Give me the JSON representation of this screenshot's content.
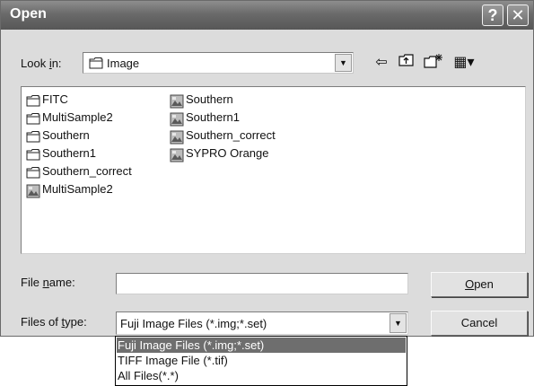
{
  "window": {
    "title": "Open",
    "help_glyph": "?",
    "close_glyph": "✕"
  },
  "lookin": {
    "label_pre": "Look ",
    "label_key": "i",
    "label_post": "n:",
    "value": "Image",
    "arrow": "▼"
  },
  "toolbar": {
    "back_glyph": "⇦",
    "up_glyph": "⇡",
    "new_folder_glyph": "✳",
    "views_glyph": "▦▾"
  },
  "files": [
    {
      "name": "FITC",
      "type": "folder"
    },
    {
      "name": "MultiSample2",
      "type": "folder"
    },
    {
      "name": "Southern",
      "type": "folder"
    },
    {
      "name": "Southern1",
      "type": "folder"
    },
    {
      "name": "Southern_correct",
      "type": "folder"
    },
    {
      "name": "MultiSample2",
      "type": "image"
    },
    {
      "name": "Southern",
      "type": "image"
    },
    {
      "name": "Southern1",
      "type": "image"
    },
    {
      "name": "Southern_correct",
      "type": "image"
    },
    {
      "name": "SYPRO Orange",
      "type": "image"
    }
  ],
  "filename": {
    "label_pre": "File ",
    "label_key": "n",
    "label_post": "ame:",
    "value": ""
  },
  "filetype": {
    "label_pre": "Files of ",
    "label_key": "t",
    "label_post": "ype:",
    "value": "Fuji Image Files (*.img;*.set)",
    "arrow": "▼"
  },
  "buttons": {
    "open_key": "O",
    "open_rest": "pen",
    "cancel": "Cancel"
  },
  "dropdown_options": [
    {
      "label": "Fuji Image Files (*.img;*.set)",
      "selected": true
    },
    {
      "label": "TIFF Image File (*.tif)",
      "selected": false
    },
    {
      "label": "All Files(*.*)",
      "selected": false
    }
  ]
}
